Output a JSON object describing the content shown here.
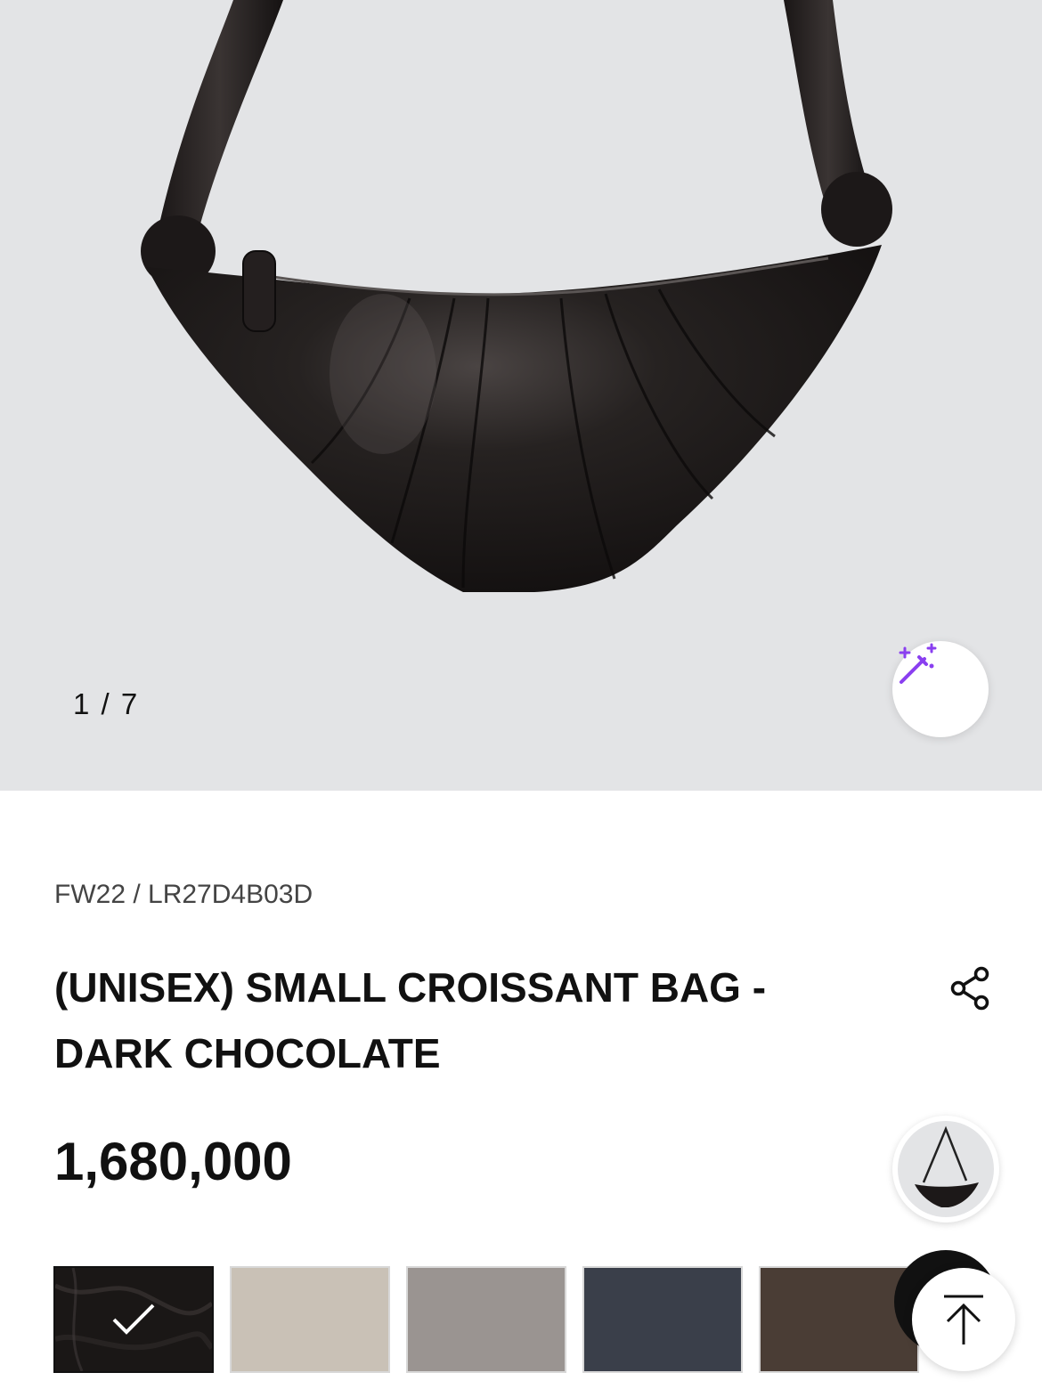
{
  "gallery": {
    "counter": "1 / 7",
    "magic_icon": "magic-wand-icon"
  },
  "product": {
    "sku": "FW22 / LR27D4B03D",
    "title": "(UNISEX) SMALL CROISSANT BAG - DARK CHOCOLATE",
    "price": "1,680,000",
    "share_icon": "share-icon"
  },
  "swatches": [
    {
      "color": "#1a1716",
      "selected": true
    },
    {
      "color": "#c9c1b6",
      "selected": false
    },
    {
      "color": "#9a9491",
      "selected": false
    },
    {
      "color": "#3a3f4a",
      "selected": false
    },
    {
      "color": "#4a3d35",
      "selected": false
    }
  ],
  "floating": {
    "scroll_top_icon": "arrow-up-icon"
  }
}
